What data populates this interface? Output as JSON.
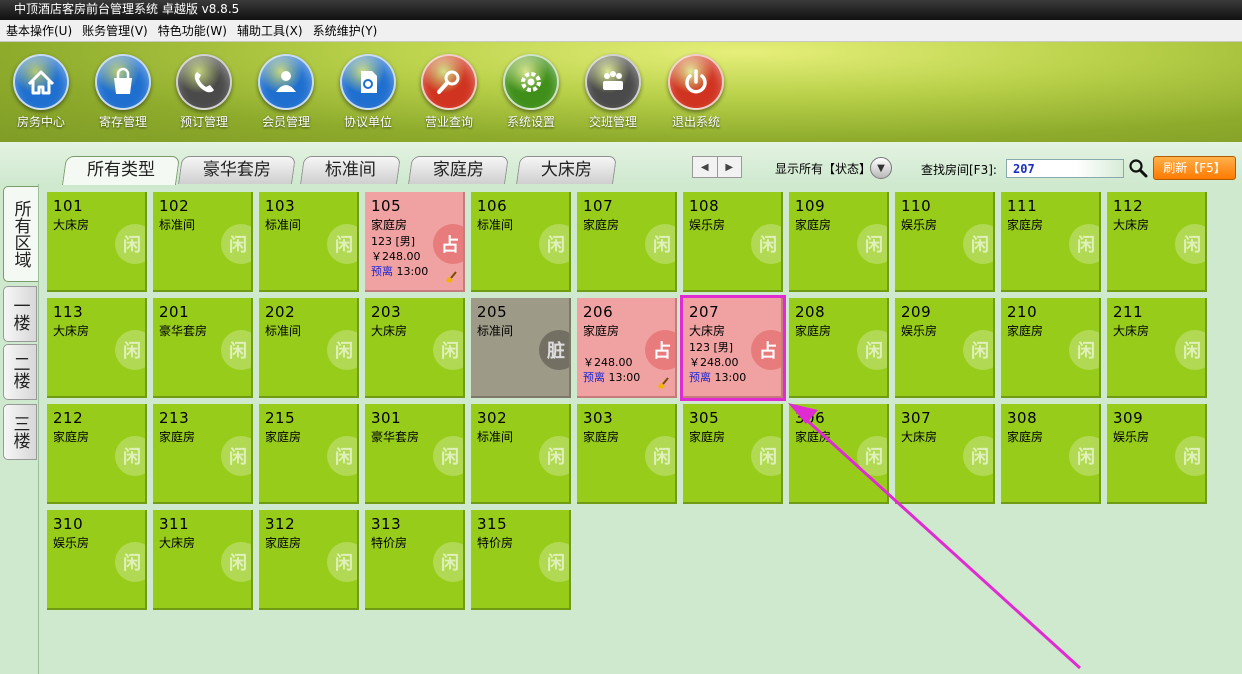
{
  "window": {
    "title": "中顶酒店客房前台管理系统 卓越版 v8.8.5"
  },
  "menu": [
    {
      "name": "basic-ops",
      "label": "基本操作(U)"
    },
    {
      "name": "accounts",
      "label": "账务管理(V)"
    },
    {
      "name": "features",
      "label": "特色功能(W)"
    },
    {
      "name": "tools",
      "label": "辅助工具(X)"
    },
    {
      "name": "maintenance",
      "label": "系统维护(Y)"
    }
  ],
  "toolbar": [
    {
      "name": "room-center",
      "label": "房务中心",
      "icon": "home-icon",
      "color": "#1f6fd0"
    },
    {
      "name": "storage",
      "label": "寄存管理",
      "icon": "bag-icon",
      "color": "#1f6fd0"
    },
    {
      "name": "booking",
      "label": "预订管理",
      "icon": "phone-icon",
      "color": "#4a4a4a"
    },
    {
      "name": "member",
      "label": "会员管理",
      "icon": "user-icon",
      "color": "#1f6fd0"
    },
    {
      "name": "agreement",
      "label": "协议单位",
      "icon": "document-icon",
      "color": "#1f6fd0"
    },
    {
      "name": "business-query",
      "label": "营业查询",
      "icon": "magnifier-icon",
      "color": "#d0331f"
    },
    {
      "name": "settings",
      "label": "系统设置",
      "icon": "gear-icon",
      "color": "#3f8f1a"
    },
    {
      "name": "handover",
      "label": "交班管理",
      "icon": "meeting-icon",
      "color": "#4a4a4a"
    },
    {
      "name": "exit",
      "label": "退出系统",
      "icon": "power-icon",
      "color": "#d0331f"
    }
  ],
  "type_tabs": [
    {
      "name": "all",
      "label": "所有类型",
      "active": true
    },
    {
      "name": "luxury",
      "label": "豪华套房",
      "active": false
    },
    {
      "name": "standard",
      "label": "标准间",
      "active": false
    },
    {
      "name": "family",
      "label": "家庭房",
      "active": false
    },
    {
      "name": "bigbed",
      "label": "大床房",
      "active": false
    }
  ],
  "floor_tabs": [
    {
      "name": "all-areas",
      "label": "所有区域",
      "active": true
    },
    {
      "name": "floor-1",
      "label": "一楼",
      "active": false
    },
    {
      "name": "floor-2",
      "label": "二楼",
      "active": false
    },
    {
      "name": "floor-3",
      "label": "三楼",
      "active": false
    }
  ],
  "filter": {
    "status_label": "显示所有【状态】",
    "search_label": "查找房间[F3]:",
    "search_value": "207",
    "refresh_label": "刷新【F5】"
  },
  "rooms": [
    {
      "num": "101",
      "type": "大床房",
      "status": "vacant",
      "badge": "闲"
    },
    {
      "num": "102",
      "type": "标准间",
      "status": "vacant",
      "badge": "闲"
    },
    {
      "num": "103",
      "type": "标准间",
      "status": "vacant",
      "badge": "闲"
    },
    {
      "num": "105",
      "type": "家庭房",
      "status": "occupied",
      "badge": "占",
      "guest": "123 [男]",
      "price": "￥248.00",
      "depart_tag": "预离",
      "depart_time": "13:00",
      "clean": true
    },
    {
      "num": "106",
      "type": "标准间",
      "status": "vacant",
      "badge": "闲"
    },
    {
      "num": "107",
      "type": "家庭房",
      "status": "vacant",
      "badge": "闲"
    },
    {
      "num": "108",
      "type": "娱乐房",
      "status": "vacant",
      "badge": "闲"
    },
    {
      "num": "109",
      "type": "家庭房",
      "status": "vacant",
      "badge": "闲"
    },
    {
      "num": "110",
      "type": "娱乐房",
      "status": "vacant",
      "badge": "闲"
    },
    {
      "num": "111",
      "type": "家庭房",
      "status": "vacant",
      "badge": "闲"
    },
    {
      "num": "112",
      "type": "大床房",
      "status": "vacant",
      "badge": "闲"
    },
    {
      "num": "113",
      "type": "大床房",
      "status": "vacant",
      "badge": "闲"
    },
    {
      "num": "201",
      "type": "豪华套房",
      "status": "vacant",
      "badge": "闲"
    },
    {
      "num": "202",
      "type": "标准间",
      "status": "vacant",
      "badge": "闲"
    },
    {
      "num": "203",
      "type": "大床房",
      "status": "vacant",
      "badge": "闲"
    },
    {
      "num": "205",
      "type": "标准间",
      "status": "dirty",
      "badge": "脏"
    },
    {
      "num": "206",
      "type": "家庭房",
      "status": "occupied",
      "badge": "占",
      "guest": "",
      "price": "￥248.00",
      "depart_tag": "预离",
      "depart_time": "13:00",
      "clean": true
    },
    {
      "num": "207",
      "type": "大床房",
      "status": "occupied",
      "badge": "占",
      "guest": "123 [男]",
      "price": "￥248.00",
      "depart_tag": "预离",
      "depart_time": "13:00",
      "selected": true
    },
    {
      "num": "208",
      "type": "家庭房",
      "status": "vacant",
      "badge": "闲"
    },
    {
      "num": "209",
      "type": "娱乐房",
      "status": "vacant",
      "badge": "闲"
    },
    {
      "num": "210",
      "type": "家庭房",
      "status": "vacant",
      "badge": "闲"
    },
    {
      "num": "211",
      "type": "大床房",
      "status": "vacant",
      "badge": "闲"
    },
    {
      "num": "212",
      "type": "家庭房",
      "status": "vacant",
      "badge": "闲"
    },
    {
      "num": "213",
      "type": "家庭房",
      "status": "vacant",
      "badge": "闲"
    },
    {
      "num": "215",
      "type": "家庭房",
      "status": "vacant",
      "badge": "闲"
    },
    {
      "num": "301",
      "type": "豪华套房",
      "status": "vacant",
      "badge": "闲"
    },
    {
      "num": "302",
      "type": "标准间",
      "status": "vacant",
      "badge": "闲"
    },
    {
      "num": "303",
      "type": "家庭房",
      "status": "vacant",
      "badge": "闲"
    },
    {
      "num": "305",
      "type": "家庭房",
      "status": "vacant",
      "badge": "闲"
    },
    {
      "num": "306",
      "type": "家庭房",
      "status": "vacant",
      "badge": "闲"
    },
    {
      "num": "307",
      "type": "大床房",
      "status": "vacant",
      "badge": "闲"
    },
    {
      "num": "308",
      "type": "家庭房",
      "status": "vacant",
      "badge": "闲"
    },
    {
      "num": "309",
      "type": "娱乐房",
      "status": "vacant",
      "badge": "闲"
    },
    {
      "num": "310",
      "type": "娱乐房",
      "status": "vacant",
      "badge": "闲"
    },
    {
      "num": "311",
      "type": "大床房",
      "status": "vacant",
      "badge": "闲"
    },
    {
      "num": "312",
      "type": "家庭房",
      "status": "vacant",
      "badge": "闲"
    },
    {
      "num": "313",
      "type": "特价房",
      "status": "vacant",
      "badge": "闲"
    },
    {
      "num": "315",
      "type": "特价房",
      "status": "vacant",
      "badge": "闲"
    }
  ]
}
